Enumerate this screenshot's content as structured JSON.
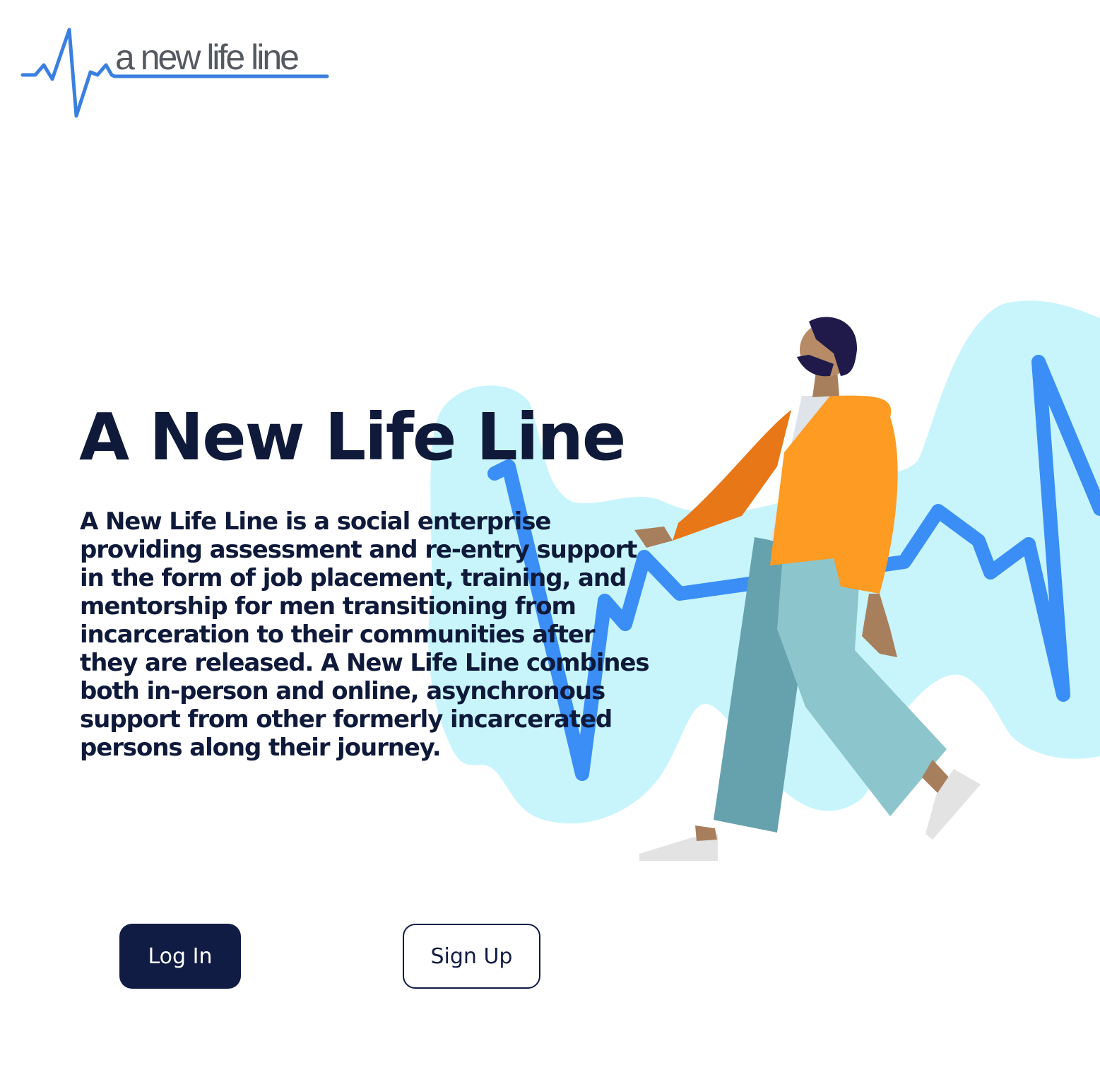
{
  "logo": {
    "text": "a new life line",
    "icon": "heartbeat-line-icon",
    "line_color": "#3a7fe0"
  },
  "hero": {
    "title": "A New Life Line",
    "description": "A New Life Line is a social enterprise providing assessment and re-entry support in the form of job placement, training, and mentorship for men transitioning from incarceration to their communities after they are released. A New Life Line combines both in-person and online, asynchronous support from other formerly incarcerated persons along their journey.",
    "illustration": "walking-man-illustration"
  },
  "actions": {
    "login_label": "Log In",
    "signup_label": "Sign Up"
  },
  "colors": {
    "navy": "#111c45",
    "heading": "#0f1a3a",
    "line_blue": "#3a8ef5",
    "blob_cyan": "#c8f5fc",
    "jacket_orange": "#fd9b23",
    "pants_teal": "#8cc5cc"
  }
}
